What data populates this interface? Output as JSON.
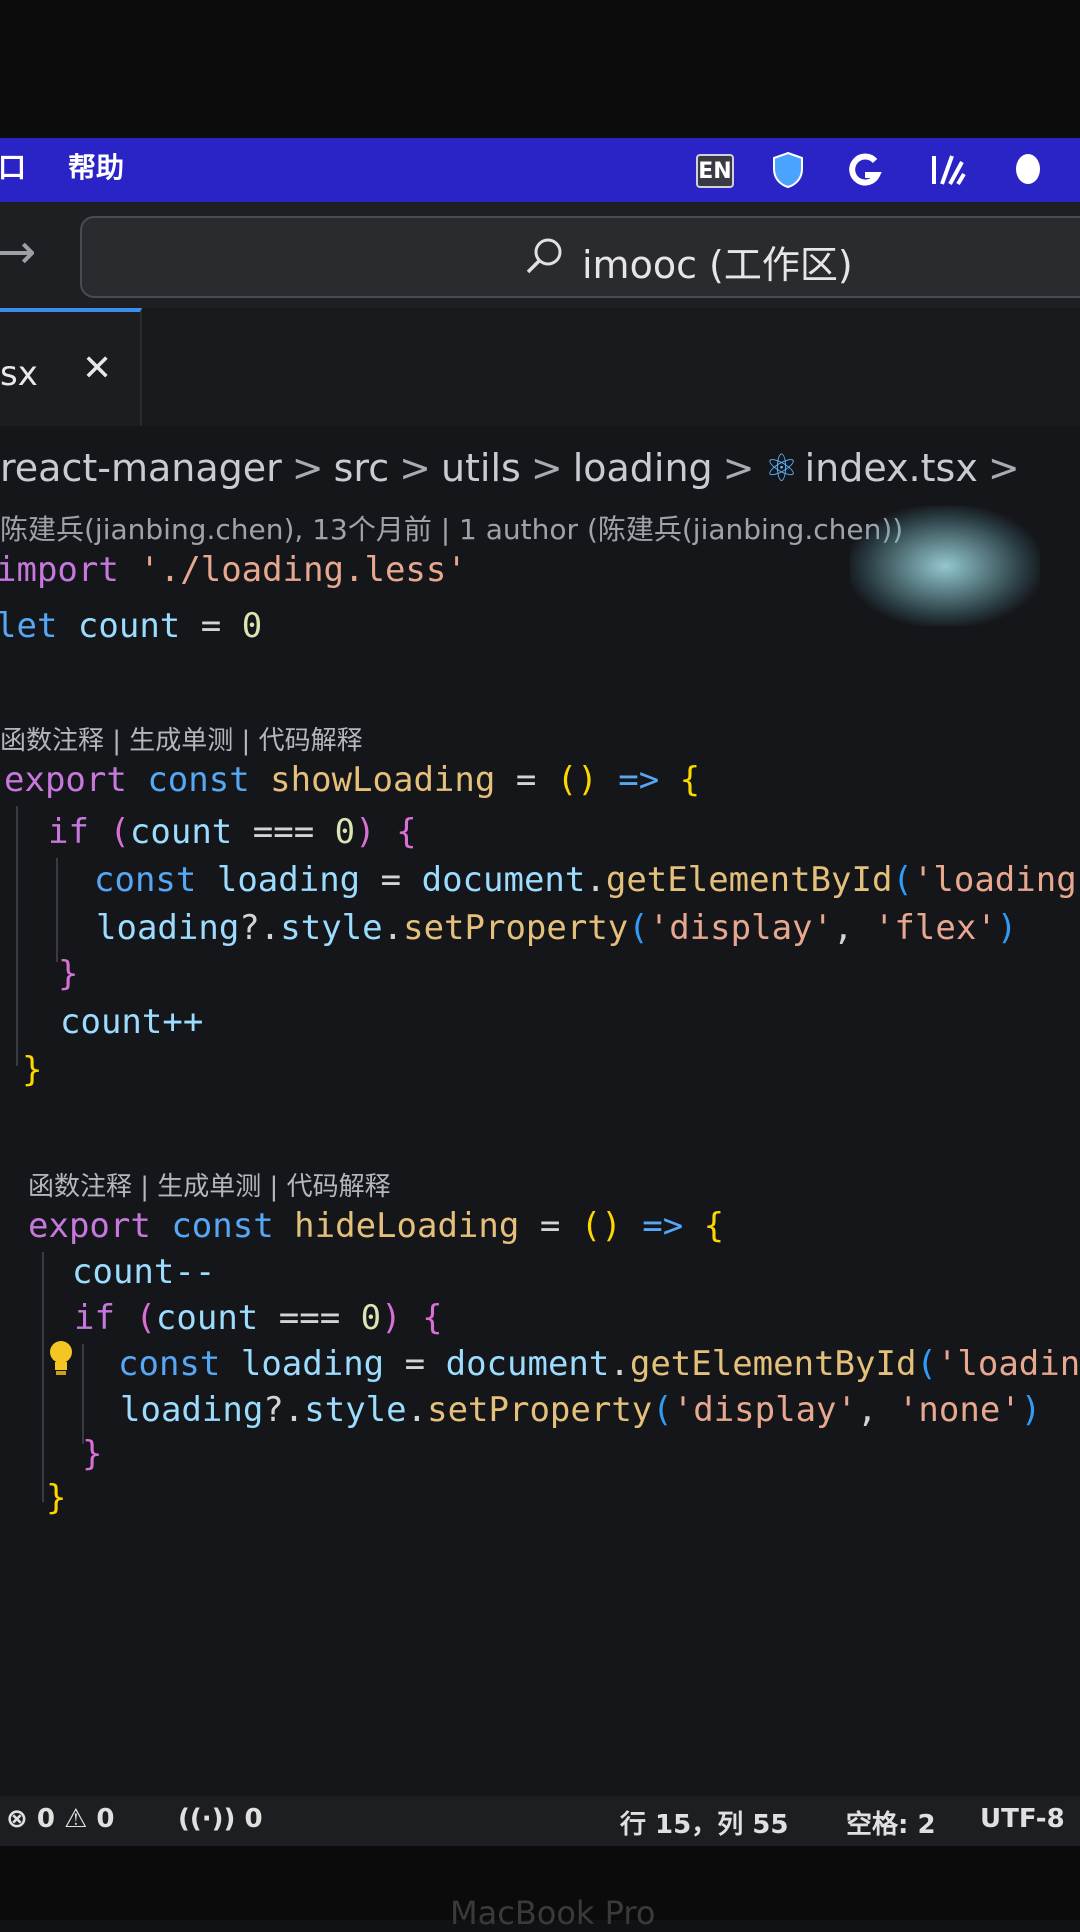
{
  "menubar": {
    "menu_window": "口",
    "menu_help": "帮助",
    "input_source": "EN"
  },
  "titlebar": {
    "command_center_label": "imooc (工作区)"
  },
  "tab": {
    "label": "sx",
    "close": "✕"
  },
  "breadcrumb": {
    "items": [
      "react-manager",
      "src",
      "utils",
      "loading",
      "index.tsx"
    ],
    "separator": ">"
  },
  "blame": "陈建兵(jianbing.chen), 13个月前 | 1 author (陈建兵(jianbing.chen))",
  "codelens": {
    "text1": "函数注释 | 生成单测 | 代码解释",
    "text2": "函数注释 | 生成单测 | 代码解释"
  },
  "status": {
    "errors": "0",
    "warnings": "0",
    "ports": "0",
    "position": "行 15，列 55",
    "indent": "空格: 2",
    "encoding": "UTF-8"
  },
  "bezel": {
    "brand": "MacBook Pro"
  }
}
